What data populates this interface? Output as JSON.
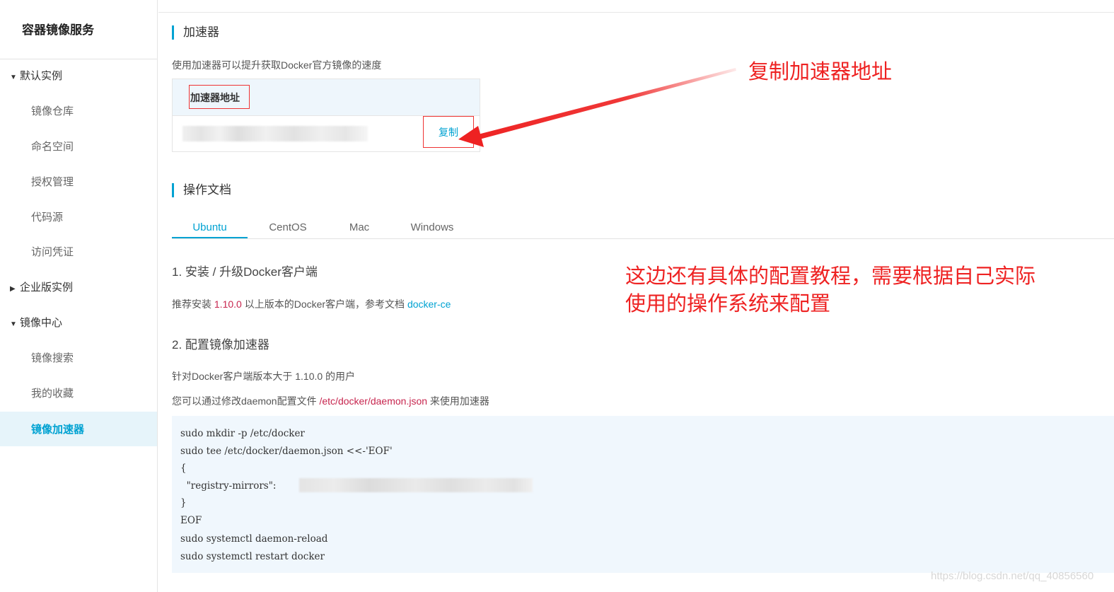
{
  "sidebar": {
    "title": "容器镜像服务",
    "groups": [
      {
        "label": "默认实例",
        "caret": "▼",
        "items": [
          "镜像仓库",
          "命名空间",
          "授权管理",
          "代码源",
          "访问凭证"
        ]
      },
      {
        "label": "企业版实例",
        "caret": "▶"
      },
      {
        "label": "镜像中心",
        "caret": "▼",
        "items": [
          "镜像搜索",
          "我的收藏",
          "镜像加速器"
        ]
      }
    ],
    "active_item": "镜像加速器"
  },
  "accelerator": {
    "title": "加速器",
    "description": "使用加速器可以提升获取Docker官方镜像的速度",
    "address_label": "加速器地址",
    "copy_label": "复制"
  },
  "annotations": {
    "copy_hint": "复制加速器地址",
    "config_hint_line1": "这边还有具体的配置教程，需要根据自己实际",
    "config_hint_line2": "使用的操作系统来配置"
  },
  "docs": {
    "title": "操作文档",
    "tabs": [
      "Ubuntu",
      "CentOS",
      "Mac",
      "Windows"
    ],
    "active_tab": "Ubuntu",
    "step1": "1. 安装 / 升级Docker客户端",
    "step1_text_a": "推荐安装 ",
    "step1_version": "1.10.0",
    "step1_text_b": " 以上版本的Docker客户端，参考文档 ",
    "step1_link": "docker-ce",
    "step2": "2. 配置镜像加速器",
    "step2_text1": "针对Docker客户端版本大于 1.10.0 的用户",
    "step2_text2_a": "您可以通过修改daemon配置文件 ",
    "step2_path": "/etc/docker/daemon.json",
    "step2_text2_b": " 来使用加速器",
    "code_lines": [
      "sudo mkdir -p /etc/docker",
      "sudo tee /etc/docker/daemon.json <<-'EOF'",
      "{",
      "  \"registry-mirrors\":",
      "}",
      "EOF",
      "sudo systemctl daemon-reload",
      "sudo systemctl restart docker"
    ]
  },
  "watermark": "https://blog.csdn.net/qq_40856560",
  "colors": {
    "accent": "#00a2d2",
    "annotation": "#ee2222",
    "highlight_text": "#c7254e"
  }
}
